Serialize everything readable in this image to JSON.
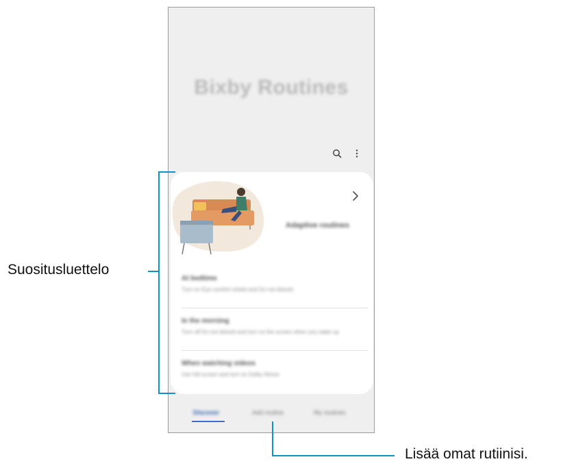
{
  "app": {
    "title": "Bixby Routines"
  },
  "toolbar": {
    "search_icon": "search-icon",
    "more_icon": "more-options-icon"
  },
  "card": {
    "heading": "Adaptive routines",
    "chevron_icon": "chevron-right-icon",
    "items": [
      {
        "title": "At bedtime",
        "subtitle": "Turn on Eye comfort shield and Do not disturb"
      },
      {
        "title": "In the morning",
        "subtitle": "Turn off Do not disturb and turn on the screen when you wake up"
      },
      {
        "title": "When watching videos",
        "subtitle": "Use full screen and turn on Dolby Atmos"
      }
    ]
  },
  "nav": {
    "tabs": [
      "Discover",
      "Add routine",
      "My routines"
    ],
    "active_index": 0
  },
  "callouts": {
    "left": "Suositusluettelo",
    "bottom": "Lisää omat rutiinisi."
  },
  "colors": {
    "accent_line": "#0e93c9",
    "active_tab": "#2f5fb0"
  }
}
